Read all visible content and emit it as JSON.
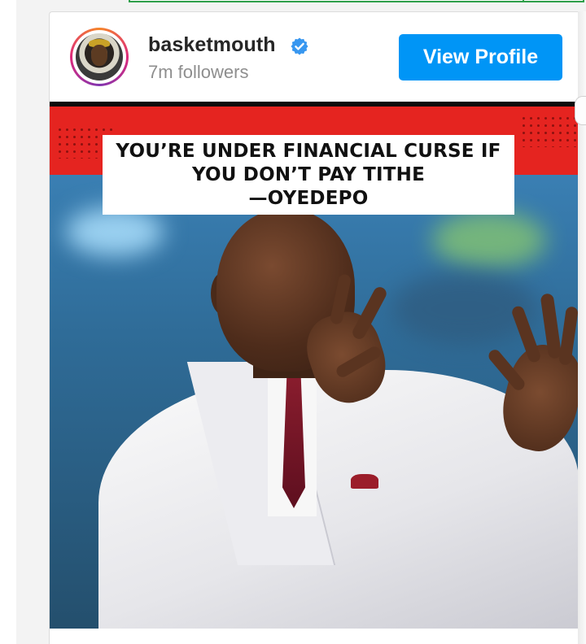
{
  "profile": {
    "username": "basketmouth",
    "verified": true,
    "followers": "7m followers",
    "view_profile_label": "View Profile",
    "avatar_icon": "profile-avatar"
  },
  "post": {
    "caption_lines": [
      "YOU’RE UNDER FINANCIAL CURSE IF",
      "YOU DON’T PAY TITHE",
      "—OYEDEPO"
    ]
  },
  "colors": {
    "button_blue": "#0095f6",
    "verified_blue": "#3897f0",
    "banner_red": "#e52420",
    "embed_border_green": "#2e9f4a"
  }
}
